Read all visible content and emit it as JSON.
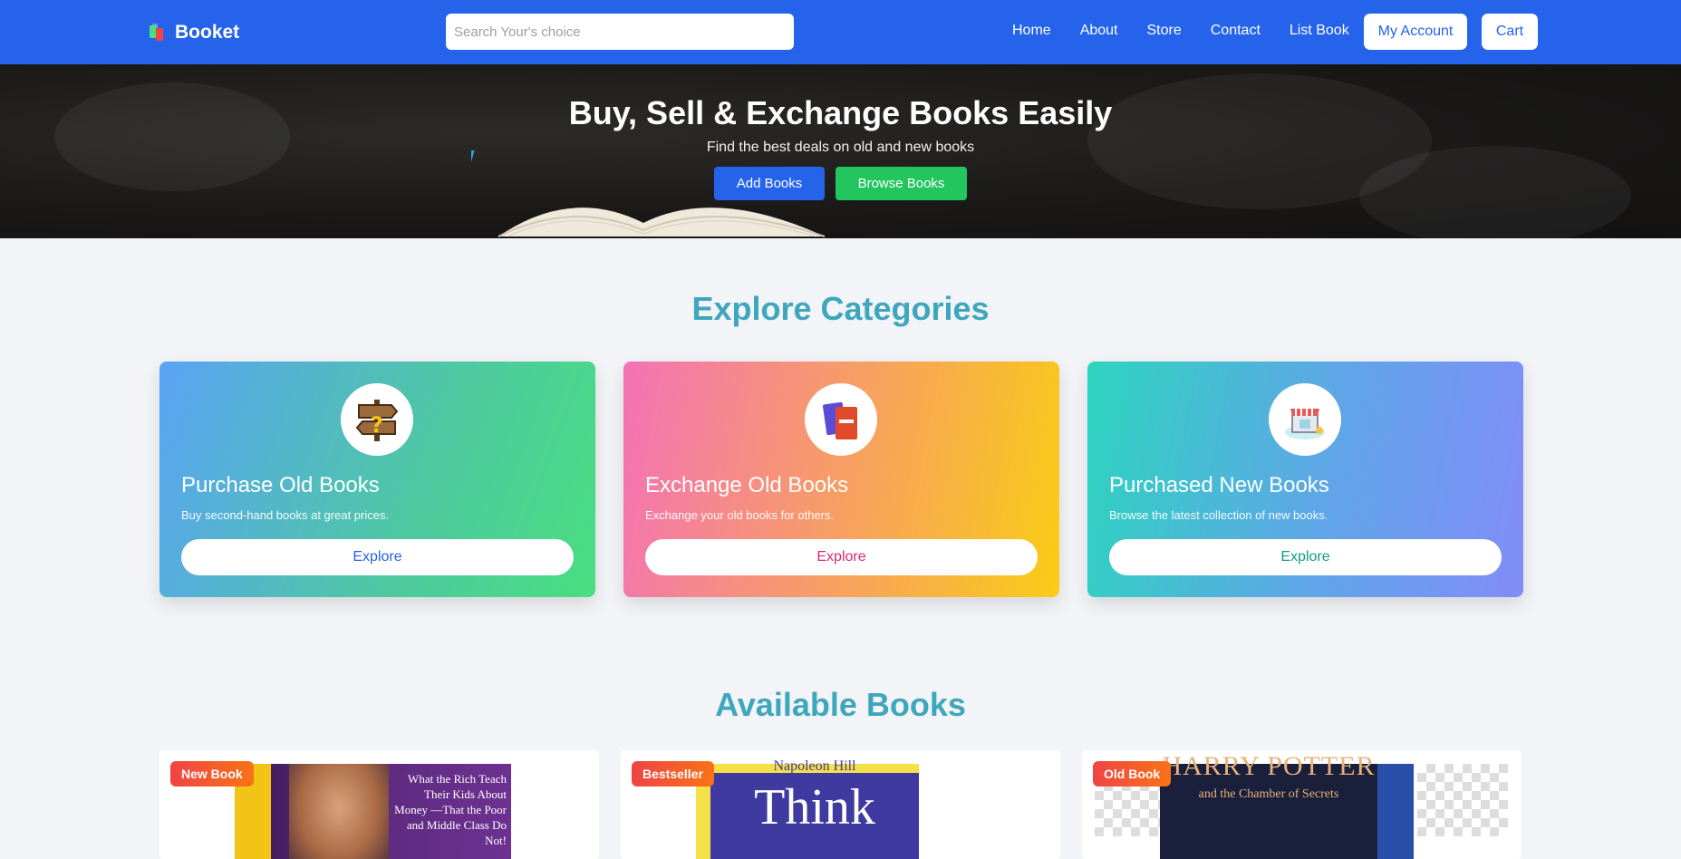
{
  "brand": {
    "name": "Booket"
  },
  "search": {
    "placeholder": "Search Your's choice"
  },
  "nav": {
    "links": [
      "Home",
      "About",
      "Store",
      "Contact",
      "List Book"
    ],
    "account": "My Account",
    "cart": "Cart"
  },
  "hero": {
    "title": "Buy, Sell & Exchange Books Easily",
    "subtitle": "Find the best deals on old and new books",
    "add_button": "Add Books",
    "browse_button": "Browse Books"
  },
  "categories": {
    "title": "Explore Categories",
    "items": [
      {
        "title": "Purchase Old Books",
        "desc": "Buy second-hand books at great prices.",
        "button": "Explore",
        "icon": "signpost-icon"
      },
      {
        "title": "Exchange Old Books",
        "desc": "Exchange your old books for others.",
        "button": "Explore",
        "icon": "books-icon"
      },
      {
        "title": "Purchased New Books",
        "desc": "Browse the latest collection of new books.",
        "button": "Explore",
        "icon": "store-icon"
      }
    ]
  },
  "books": {
    "title": "Available Books",
    "items": [
      {
        "badge": "New Book",
        "cover_text": "What the Rich Teach Their Kids About Money —That the Poor and Middle Class Do Not!"
      },
      {
        "badge": "Bestseller",
        "cover_top": "Napoleon Hill",
        "cover_title": "Think"
      },
      {
        "badge": "Old Book",
        "cover_title": "HARRY POTTER",
        "cover_sub": "and the Chamber of Secrets"
      }
    ]
  }
}
